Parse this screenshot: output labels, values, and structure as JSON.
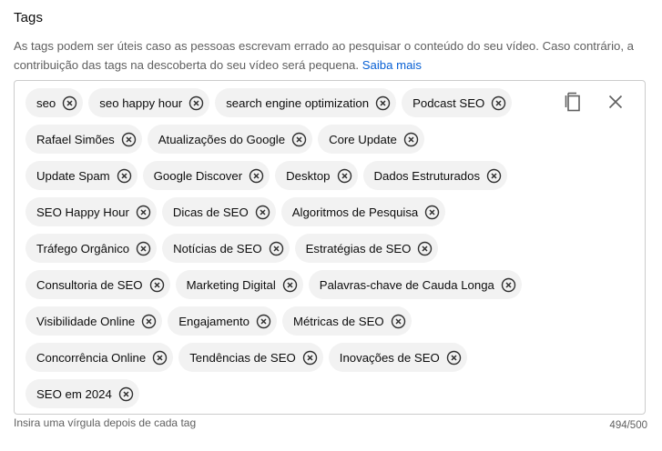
{
  "section": {
    "title": "Tags",
    "description": "As tags podem ser úteis caso as pessoas escrevam errado ao pesquisar o conteúdo do seu vídeo. Caso contrário, a contribuição das tags na descoberta do seu vídeo será pequena.",
    "learn_more": "Saiba mais"
  },
  "tag_rows": [
    [
      "seo",
      "seo happy hour",
      "search engine optimization",
      "Podcast SEO"
    ],
    [
      "Rafael Simões",
      "Atualizações do Google",
      "Core Update"
    ],
    [
      "Update Spam",
      "Google Discover",
      "Desktop",
      "Dados Estruturados"
    ],
    [
      "SEO Happy Hour",
      "Dicas de SEO",
      "Algoritmos de Pesquisa"
    ],
    [
      "Tráfego Orgânico",
      "Notícias de SEO",
      "Estratégias de SEO"
    ],
    [
      "Consultoria de SEO",
      "Marketing Digital",
      "Palavras-chave de Cauda Longa"
    ],
    [
      "Visibilidade Online",
      "Engajamento",
      "Métricas de SEO"
    ],
    [
      "Concorrência Online",
      "Tendências de SEO",
      "Inovações de SEO"
    ],
    [
      "SEO em 2024"
    ]
  ],
  "actions": {
    "copy_icon": "copy-icon",
    "clear_icon": "close-icon"
  },
  "footer": {
    "hint": "Insira uma vírgula depois de cada tag",
    "counter": "494/500"
  },
  "colors": {
    "chip_background": "#f2f2f2",
    "link": "#065fd4",
    "secondary_text": "#606060"
  }
}
